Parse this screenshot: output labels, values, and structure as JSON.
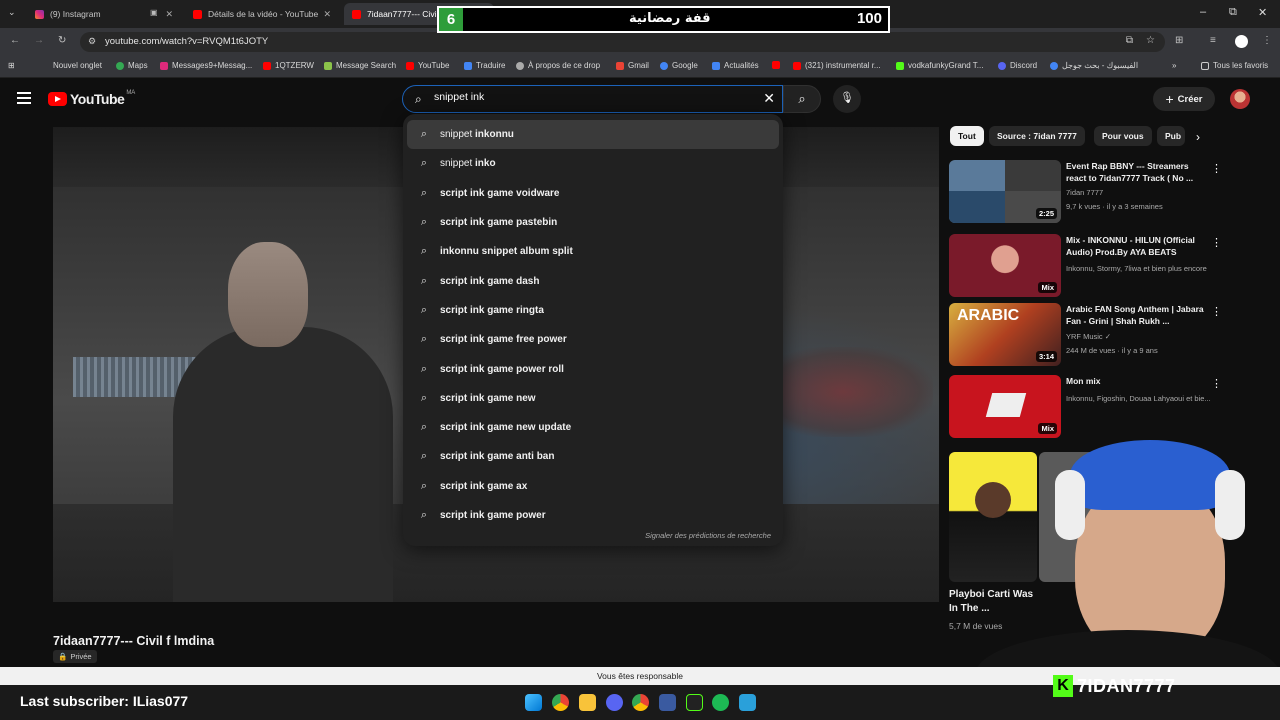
{
  "browser": {
    "tabs": [
      {
        "label": "(9) Instagram"
      },
      {
        "label": "Détails de la vidéo - YouTube S"
      },
      {
        "label": "7idaan7777--- Civil"
      }
    ],
    "url": "youtube.com/watch?v=RVQM1t6JOTY",
    "bookmarks": [
      "Nouvel onglet",
      "Maps",
      "Messages9+Messag...",
      "1QTZERW",
      "Message Search",
      "YouTube",
      "Traduire",
      "À propos de ce drop",
      "Gmail",
      "Google",
      "Actualités",
      "(321) instrumental r...",
      "vodkafunkyGrand T...",
      "Discord",
      "الفيسبوك - بحث جوجل"
    ],
    "all_bookmarks": "Tous les favoris"
  },
  "youtube": {
    "logo": "YouTube",
    "region": "MA",
    "search_value": "snippet ink",
    "create_label": "Créer",
    "suggestions": [
      {
        "pre": "snippet ",
        "bold": "inkonnu"
      },
      {
        "pre": "snippet ",
        "bold": "inko"
      },
      {
        "pre": "",
        "bold": "script ink game voidware"
      },
      {
        "pre": "",
        "bold": "script ink game pastebin"
      },
      {
        "pre": "",
        "bold": "inkonnu snippet album split"
      },
      {
        "pre": "",
        "bold": "script ink game dash"
      },
      {
        "pre": "",
        "bold": "script ink game ringta"
      },
      {
        "pre": "",
        "bold": "script ink game free power"
      },
      {
        "pre": "",
        "bold": "script ink game power roll"
      },
      {
        "pre": "",
        "bold": "script ink game new"
      },
      {
        "pre": "",
        "bold": "script ink game new update"
      },
      {
        "pre": "",
        "bold": "script ink game anti ban"
      },
      {
        "pre": "",
        "bold": "script ink game ax"
      },
      {
        "pre": "",
        "bold": "script ink game power"
      }
    ],
    "report_predictions": "Signaler des prédictions de recherche",
    "video_title": "7idaan7777--- Civil f lmdina",
    "private_label": "Privée",
    "chips": [
      "Tout",
      "Source : 7idan 7777",
      "Pour vous",
      "Pub"
    ],
    "related": [
      {
        "title": "Event Rap BBNY --- Streamers react to 7idan7777 Track ( No ...",
        "channel": "7idan 7777",
        "meta": "9,7 k vues · il y a 3 semaines",
        "duration": "2:25"
      },
      {
        "title": "Mix - INKONNU - HILUN (Official Audio) Prod.By AYA BEATS",
        "channel": "Inkonnu, Stormy, 7liwa et bien plus encore",
        "meta": "",
        "duration": "Mix"
      },
      {
        "title": "Arabic FAN Song Anthem | Jabara Fan - Grini | Shah Rukh ...",
        "channel": "YRF Music ✓",
        "meta": "244 M de vues · il y a 9 ans",
        "duration": "3:14"
      },
      {
        "title": "Mon mix",
        "channel": "Inkonnu, Figoshin, Douaa Lahyaoui et bie...",
        "meta": "",
        "duration": "Mix"
      }
    ],
    "short": {
      "title": "Playboi Carti Was In The ...",
      "views": "5,7 M de vues"
    }
  },
  "overlay": {
    "counter_left": "6",
    "counter_arabic": "قفة رمضانية",
    "counter_right": "100",
    "notification": "Vous êtes responsable",
    "last_subscriber": "Last subscriber: ILias077",
    "brand": "7IDAN7777",
    "brand_k": "K"
  },
  "colors": {
    "yt_red": "#ff0000",
    "kick_green": "#53fc18",
    "counter_green": "#2e9d3a",
    "search_focus": "#1c62b9"
  }
}
